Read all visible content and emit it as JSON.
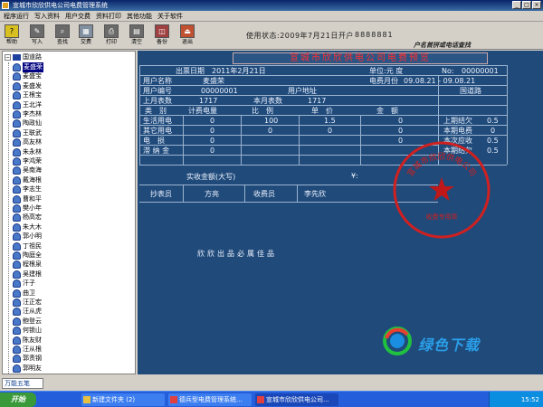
{
  "window": {
    "title": "宣城市欣欣供电公司电费管理系统"
  },
  "menu": [
    "程序运行",
    "写入资料",
    "用户交费",
    "资料打印",
    "其他功能",
    "关于软件"
  ],
  "toolbar": {
    "buttons": [
      {
        "label": "帮助",
        "icon": "help-icon"
      },
      {
        "label": "写入",
        "icon": "write-icon"
      },
      {
        "label": "查找",
        "icon": "search-icon"
      },
      {
        "label": "交费",
        "icon": "calculator-icon"
      },
      {
        "label": "打印",
        "icon": "print-icon"
      },
      {
        "label": "清空",
        "icon": "clear-icon"
      },
      {
        "label": "备份",
        "icon": "backup-icon"
      },
      {
        "label": "退出",
        "icon": "exit-icon"
      }
    ],
    "status": "使用状态:2009年7月21日开户",
    "status_number": "8888881",
    "slogan": "户名首拼或电话查找"
  },
  "tree": {
    "root": "国道路",
    "items": [
      "麦盛荣",
      "麦盛宝",
      "麦盛发",
      "王根宝",
      "王北洋",
      "李杰林",
      "陶政仙",
      "王联武",
      "高友林",
      "朱永林",
      "李鸿荣",
      "吴南海",
      "戴海根",
      "李志生",
      "曹和平",
      "樊小年",
      "杨高宏",
      "朱大木",
      "郭小明",
      "丁祖民",
      "陶庭全",
      "程根泉",
      "吴建根",
      "汗子",
      "曲卫",
      "汪正宏",
      "汪从虎",
      "鲍登云",
      "何锁山",
      "陈友财",
      "汪从根",
      "郭责钢",
      "郭明友"
    ],
    "selected": 0
  },
  "bill": {
    "title": "宣城市欣欣供电公司电费预览",
    "issue_date_label": "出票日期",
    "issue_date": "2011年2月21日",
    "unit_label": "单位:元 度",
    "no_label": "No:",
    "no": "00000001",
    "name_label": "用户名称",
    "name": "麦盛荣",
    "month_label": "电费月份",
    "month": "09.08.21 - 09.08.21",
    "code_label": "用户编号",
    "code": "00000001",
    "addr_label": "用户地址",
    "addr": "国道路",
    "last_label": "上月表数",
    "last": "1717",
    "current_label": "本月表数",
    "current": "1717",
    "headers": [
      "类　别",
      "计费电量",
      "比　例",
      "单　价",
      "金　额"
    ],
    "rows": [
      {
        "cat": "生活用电",
        "qty": "0",
        "ratio": "100",
        "price": "1.5",
        "amount": "0"
      },
      {
        "cat": "其它用电",
        "qty": "0",
        "ratio": "0",
        "price": "0",
        "amount": "0"
      },
      {
        "cat": "电　损",
        "qty": "0",
        "ratio": "",
        "price": "",
        "amount": "0"
      },
      {
        "cat": "滞 纳 金",
        "qty": "0",
        "ratio": "",
        "price": "",
        "amount": ""
      }
    ],
    "side": [
      {
        "label": "上期结欠",
        "value": "0.5"
      },
      {
        "label": "本期电费",
        "value": "0"
      },
      {
        "label": "本次应收",
        "value": "0.5"
      },
      {
        "label": "本期结欠",
        "value": "0.5"
      }
    ],
    "amount_label": "实收金额(大写)",
    "amount_sym": "¥:",
    "meter_reader_label": "抄表员",
    "meter_reader": "方亮",
    "cashier_label": "收费员",
    "cashier": "李先欣",
    "footer": "欣欣出品必属佳品",
    "stamp_text": "宣城市欣欣供电公司",
    "stamp_sub": "收费专用章"
  },
  "watermark": "绿色下载",
  "taskbar": {
    "start": "开始",
    "tasks": [
      "新建文件夹 (2)",
      "德兵型电费管理系统...",
      "宣城市欣欣供电公司..."
    ],
    "clock": "15:52",
    "ime": "万能五笔"
  },
  "colors": {
    "panel": "#1f4a7a",
    "title_red": "#ff3030",
    "stamp_red": "#d02020"
  }
}
